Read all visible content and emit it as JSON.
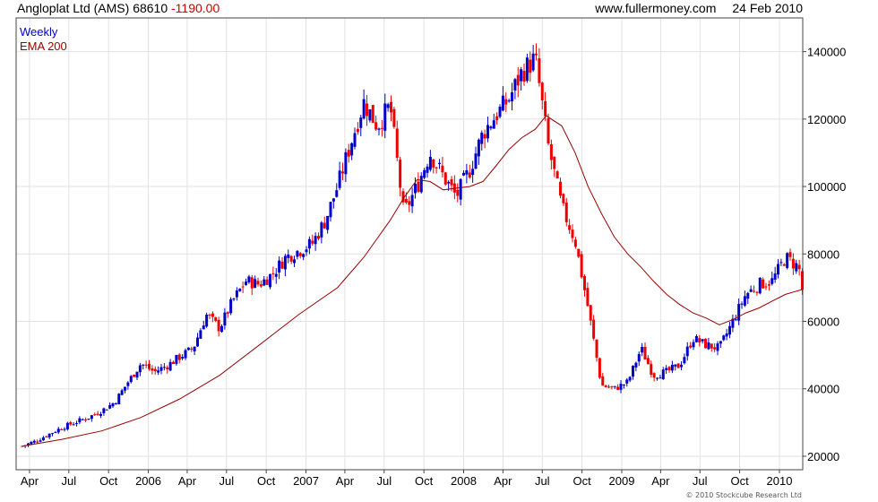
{
  "header": {
    "instrument": "Angloplat Ltd (AMS)",
    "last_price": "68610",
    "change": "-1190.00",
    "website": "www.fullermoney.com",
    "date": "24 Feb 2010"
  },
  "colors": {
    "up": "#0000cc",
    "down": "#ee0000",
    "ema": "#990000",
    "grid": "#e2e2e2",
    "frame": "#444444"
  },
  "copyright": "© 2010 Stockcube Research Ltd",
  "chart_data": {
    "type": "line",
    "style": "weekly candlestick bars with moving average",
    "legend": [
      {
        "label": "Weekly",
        "color": "#0000cc"
      },
      {
        "label": "EMA 200",
        "color": "#990000"
      }
    ],
    "legend_position": "top-left",
    "grid": true,
    "x_ticks": [
      "Apr",
      "Jul",
      "Oct",
      "2006",
      "Apr",
      "Jul",
      "Oct",
      "2007",
      "Apr",
      "Jul",
      "Oct",
      "2008",
      "Apr",
      "Jul",
      "Oct",
      "2009",
      "Apr",
      "Jul",
      "Oct",
      "2010"
    ],
    "x_tick_dates": [
      "2005-04-01",
      "2005-07-01",
      "2005-10-01",
      "2006-01-01",
      "2006-04-01",
      "2006-07-01",
      "2006-10-01",
      "2007-01-01",
      "2007-04-01",
      "2007-07-01",
      "2007-10-01",
      "2008-01-01",
      "2008-04-01",
      "2008-07-01",
      "2008-10-01",
      "2009-01-01",
      "2009-04-01",
      "2009-07-01",
      "2009-10-01",
      "2010-01-01"
    ],
    "xlim": [
      "2005-03-01",
      "2010-02-24"
    ],
    "y_ticks": [
      20000,
      40000,
      60000,
      80000,
      100000,
      120000,
      140000
    ],
    "y_tick_labels": [
      "20000",
      "40000",
      "60000",
      "80000",
      "100000",
      "120000",
      "140000"
    ],
    "ylim": [
      16000,
      150000
    ],
    "y_axis_side": "right",
    "price_series": {
      "name": "Weekly",
      "x": [
        "2005-03-15",
        "2005-04-15",
        "2005-05-15",
        "2005-06-15",
        "2005-07-15",
        "2005-08-15",
        "2005-09-15",
        "2005-10-15",
        "2005-11-15",
        "2005-12-15",
        "2006-01-15",
        "2006-02-15",
        "2006-03-15",
        "2006-04-15",
        "2006-05-15",
        "2006-06-15",
        "2006-07-15",
        "2006-08-15",
        "2006-09-15",
        "2006-10-15",
        "2006-11-15",
        "2006-12-15",
        "2007-01-15",
        "2007-02-15",
        "2007-03-15",
        "2007-04-15",
        "2007-05-15",
        "2007-06-15",
        "2007-07-15",
        "2007-08-15",
        "2007-09-15",
        "2007-10-15",
        "2007-11-15",
        "2007-12-15",
        "2008-01-15",
        "2008-02-15",
        "2008-03-15",
        "2008-04-15",
        "2008-05-15",
        "2008-06-15",
        "2008-07-15",
        "2008-08-15",
        "2008-09-15",
        "2008-10-15",
        "2008-11-15",
        "2008-12-15",
        "2009-01-15",
        "2009-02-15",
        "2009-03-15",
        "2009-04-15",
        "2009-05-15",
        "2009-06-15",
        "2009-07-15",
        "2009-08-15",
        "2009-09-15",
        "2009-10-15",
        "2009-11-15",
        "2009-12-15",
        "2010-01-15",
        "2010-02-15",
        "2010-02-24"
      ],
      "y": [
        23000,
        24500,
        26500,
        28500,
        30000,
        31500,
        33500,
        36000,
        42000,
        47500,
        45000,
        47000,
        49500,
        52000,
        62000,
        58000,
        66000,
        72000,
        71000,
        74000,
        79000,
        81000,
        83000,
        90000,
        100000,
        113000,
        125000,
        118000,
        124000,
        92000,
        100000,
        110000,
        103000,
        97000,
        105000,
        116000,
        121000,
        126000,
        134000,
        138000,
        112000,
        94000,
        84000,
        64000,
        41000,
        40000,
        42000,
        52000,
        44000,
        45000,
        47000,
        55000,
        53000,
        52000,
        60000,
        68000,
        71000,
        72000,
        79000,
        76000,
        68610
      ]
    },
    "ema_series": {
      "name": "EMA 200",
      "x": [
        "2005-03-15",
        "2005-06-15",
        "2005-09-15",
        "2005-12-15",
        "2006-03-15",
        "2006-06-15",
        "2006-09-15",
        "2006-12-15",
        "2007-03-15",
        "2007-05-15",
        "2007-07-15",
        "2007-08-15",
        "2007-09-15",
        "2007-10-15",
        "2007-11-15",
        "2007-12-15",
        "2008-01-15",
        "2008-02-15",
        "2008-03-15",
        "2008-04-15",
        "2008-05-15",
        "2008-06-15",
        "2008-07-10",
        "2008-08-15",
        "2008-09-15",
        "2008-10-15",
        "2008-11-15",
        "2008-12-15",
        "2009-01-15",
        "2009-02-15",
        "2009-03-15",
        "2009-04-15",
        "2009-05-15",
        "2009-06-15",
        "2009-07-15",
        "2009-08-15",
        "2009-09-15",
        "2009-10-15",
        "2009-11-15",
        "2009-12-15",
        "2010-01-15",
        "2010-02-24"
      ],
      "y": [
        23000,
        25000,
        27500,
        31500,
        37000,
        44000,
        53000,
        62000,
        70000,
        79000,
        90000,
        96500,
        102000,
        101500,
        99000,
        99500,
        100000,
        101500,
        106000,
        111000,
        114500,
        117000,
        121000,
        118000,
        110000,
        100000,
        92000,
        85000,
        80000,
        76000,
        72000,
        68000,
        65000,
        62500,
        61000,
        59000,
        60500,
        62500,
        64000,
        66000,
        68000,
        69500
      ]
    }
  }
}
